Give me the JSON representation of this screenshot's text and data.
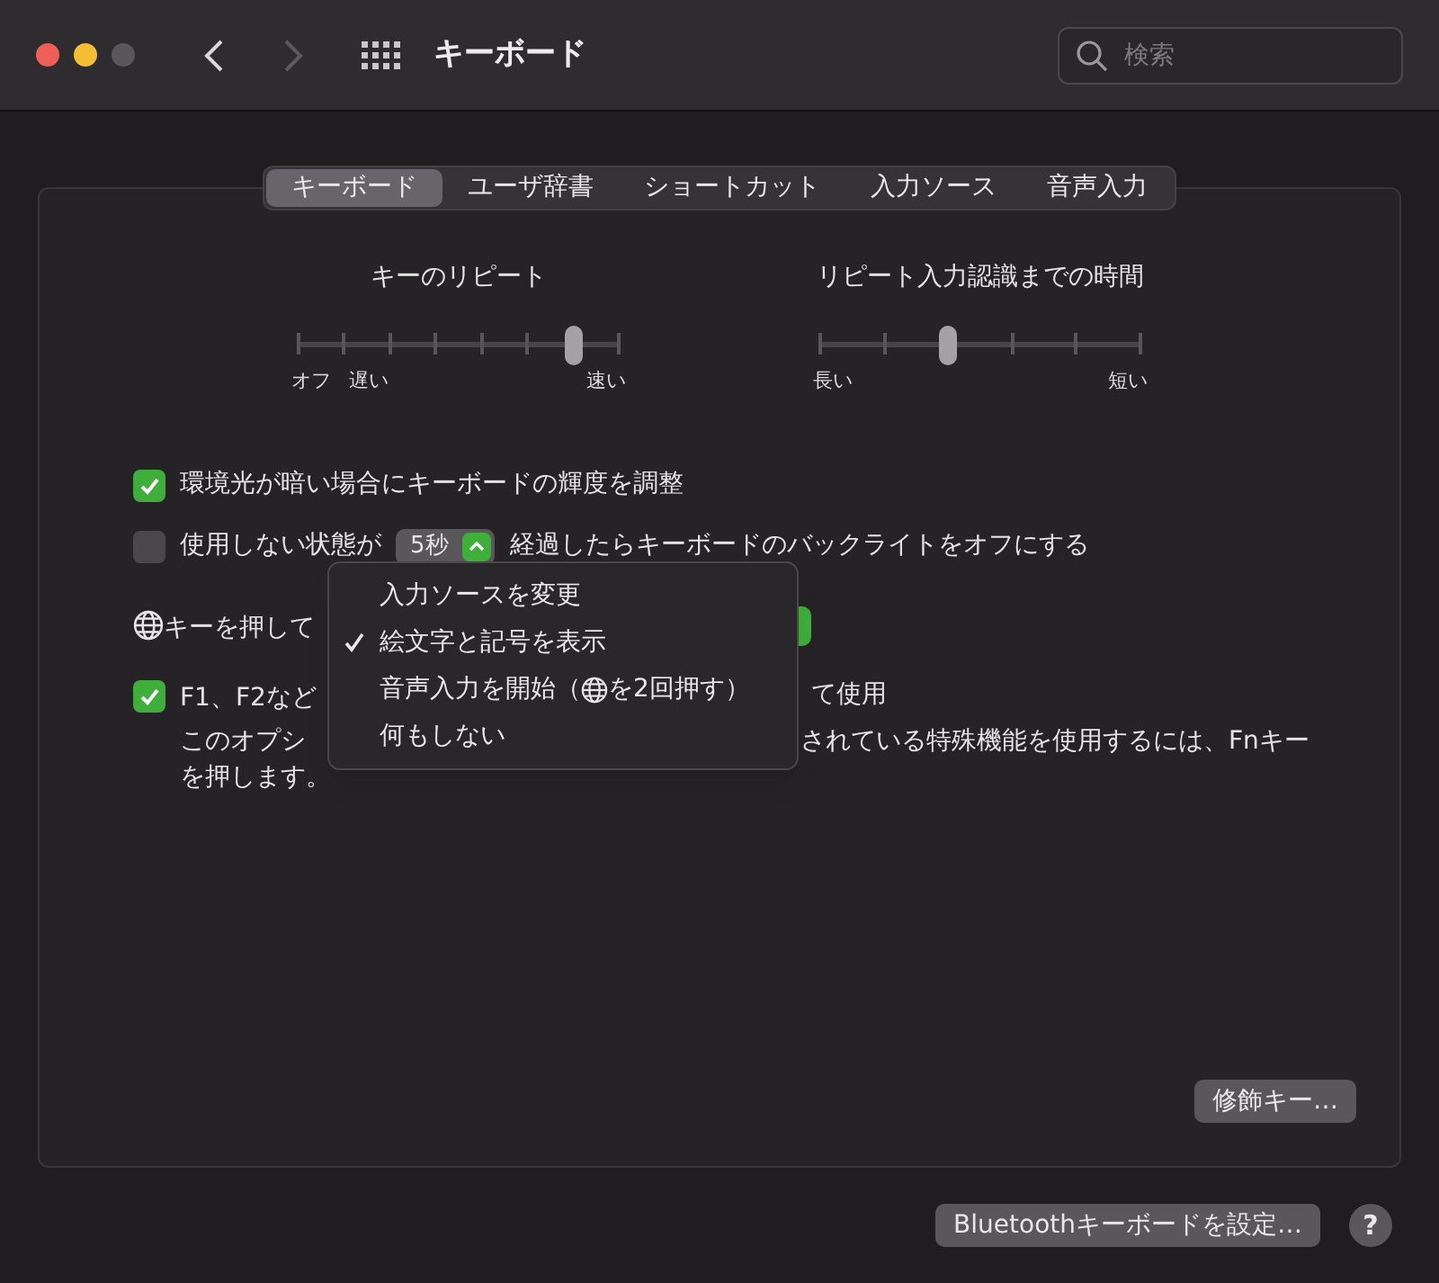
{
  "window": {
    "title": "キーボード"
  },
  "search": {
    "placeholder": "検索"
  },
  "tabs": [
    {
      "label": "キーボード",
      "selected": true
    },
    {
      "label": "ユーザ辞書",
      "selected": false
    },
    {
      "label": "ショートカット",
      "selected": false
    },
    {
      "label": "入力ソース",
      "selected": false
    },
    {
      "label": "音声入力",
      "selected": false
    }
  ],
  "sliders": [
    {
      "title": "キーのリピート",
      "level": 0.857,
      "labels_left": [
        "オフ",
        "遅い"
      ],
      "label_right": "速い"
    },
    {
      "title": "リピート入力認識までの時間",
      "level": 0.4,
      "labels_left": [
        "長い"
      ],
      "label_right": "短い"
    }
  ],
  "options": [
    {
      "kind": "checkbox",
      "checked": true,
      "label": "環境光が暗い場合にキーボードの輝度を調整"
    },
    {
      "kind": "checkbox-popup",
      "checked": false,
      "label_before": "使用しない状態が",
      "popup": "5秒",
      "label_after": "経過したらキーボードのバックライトをオフにする"
    },
    {
      "kind": "globe-popup",
      "label": "キーを押して"
    },
    {
      "kind": "checkbox-split",
      "checked": true,
      "label_left": "F1、F2など",
      "label_right": "て使用",
      "note_left": "このオプシ",
      "note_right": "されている特殊機能を使用するには、Fnキー",
      "note_end": "を押します。"
    }
  ],
  "menu": [
    {
      "label": "入力ソースを変更",
      "selected": false
    },
    {
      "label": "絵文字と記号を表示",
      "selected": true
    },
    {
      "kind": "with-globe",
      "label": "音声入力を開始（",
      "label_after": "を2回押す）",
      "selected": false
    },
    {
      "label": "何もしない",
      "selected": false
    }
  ],
  "modifier_button": "修飾キー…",
  "bluetooth_button": "Bluetoothキーボードを設定…",
  "help_button": "?"
}
